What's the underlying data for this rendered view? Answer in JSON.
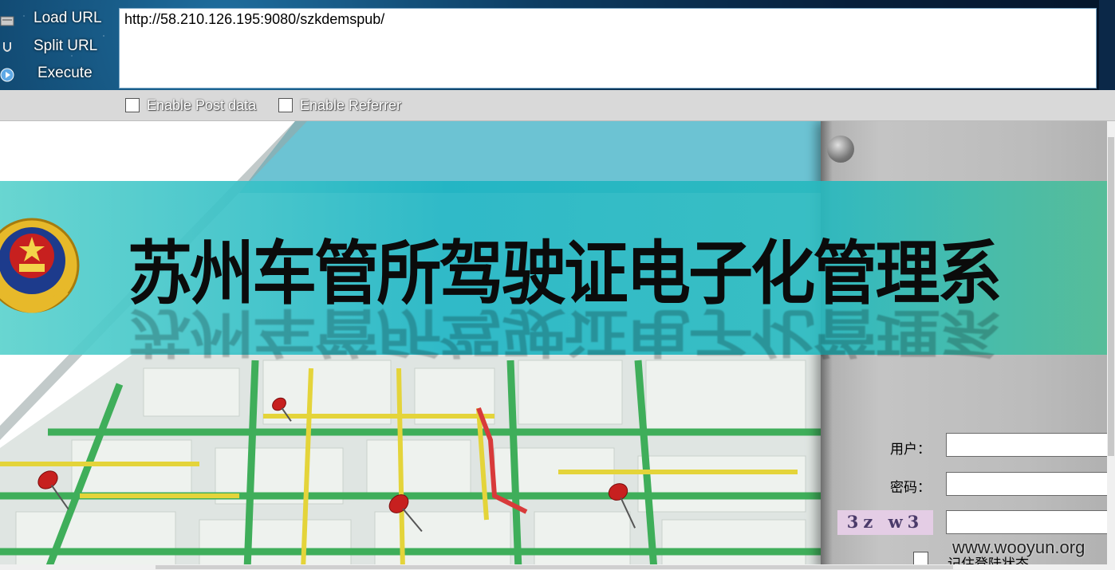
{
  "toolbar": {
    "load_label": "Load URL",
    "split_label": "Split URL",
    "execute_label": "Execute",
    "url_value": "http://58.210.126.195:9080/szkdemspub/"
  },
  "options": {
    "post_label": "Enable Post data",
    "referrer_label": "Enable Referrer"
  },
  "page": {
    "title": "苏州车管所驾驶证电子化管理系",
    "username_label": "用户：",
    "password_label": "密码：",
    "captcha_text": "3z w3",
    "remember_label": "记住登陆状态",
    "watermark": "www.wooyun.org"
  },
  "colors": {
    "toolbar_bg": "#0d3d63",
    "banner": "#1fb4c3",
    "panel": "#bcbcbc",
    "captcha_bg": "#e4cde5"
  }
}
